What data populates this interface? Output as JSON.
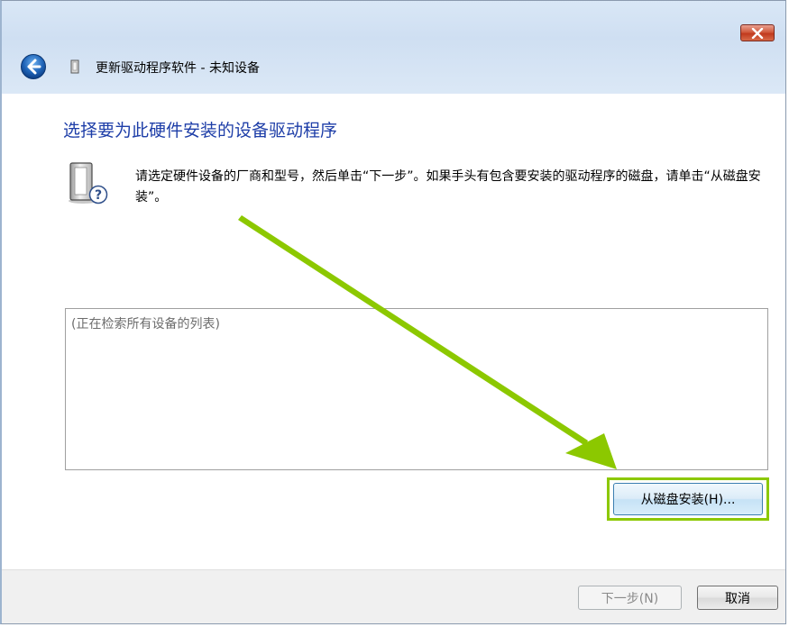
{
  "window": {
    "title": "更新驱动程序软件 - 未知设备"
  },
  "main": {
    "heading": "选择要为此硬件安装的设备驱动程序",
    "instruction": "请选定硬件设备的厂商和型号，然后单击“下一步”。如果手头有包含要安装的驱动程序的磁盘，请单击“从磁盘安装”。",
    "list_placeholder": "(正在检索所有设备的列表)",
    "have_disk_label": "从磁盘安装(H)..."
  },
  "footer": {
    "next_label": "下一步(N)",
    "cancel_label": "取消"
  },
  "icons": {
    "back": "back-arrow-icon",
    "close": "close-icon",
    "device": "device-question-icon",
    "title_device": "device-icon",
    "annotation": "green-arrow-icon"
  },
  "colors": {
    "heading": "#1e3ea8",
    "annotation": "#8cc800",
    "close_button": "#c13a1e",
    "back_button": "#1f64b8"
  }
}
